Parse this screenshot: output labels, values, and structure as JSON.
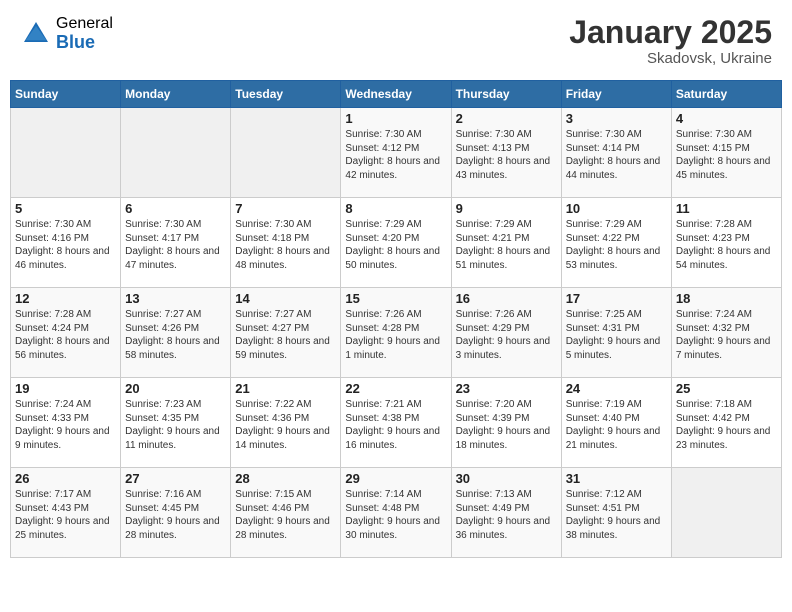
{
  "header": {
    "logo_general": "General",
    "logo_blue": "Blue",
    "month_year": "January 2025",
    "location": "Skadovsk, Ukraine"
  },
  "weekdays": [
    "Sunday",
    "Monday",
    "Tuesday",
    "Wednesday",
    "Thursday",
    "Friday",
    "Saturday"
  ],
  "weeks": [
    [
      {
        "day": "",
        "sunrise": "",
        "sunset": "",
        "daylight": ""
      },
      {
        "day": "",
        "sunrise": "",
        "sunset": "",
        "daylight": ""
      },
      {
        "day": "",
        "sunrise": "",
        "sunset": "",
        "daylight": ""
      },
      {
        "day": "1",
        "sunrise": "Sunrise: 7:30 AM",
        "sunset": "Sunset: 4:12 PM",
        "daylight": "Daylight: 8 hours and 42 minutes."
      },
      {
        "day": "2",
        "sunrise": "Sunrise: 7:30 AM",
        "sunset": "Sunset: 4:13 PM",
        "daylight": "Daylight: 8 hours and 43 minutes."
      },
      {
        "day": "3",
        "sunrise": "Sunrise: 7:30 AM",
        "sunset": "Sunset: 4:14 PM",
        "daylight": "Daylight: 8 hours and 44 minutes."
      },
      {
        "day": "4",
        "sunrise": "Sunrise: 7:30 AM",
        "sunset": "Sunset: 4:15 PM",
        "daylight": "Daylight: 8 hours and 45 minutes."
      }
    ],
    [
      {
        "day": "5",
        "sunrise": "Sunrise: 7:30 AM",
        "sunset": "Sunset: 4:16 PM",
        "daylight": "Daylight: 8 hours and 46 minutes."
      },
      {
        "day": "6",
        "sunrise": "Sunrise: 7:30 AM",
        "sunset": "Sunset: 4:17 PM",
        "daylight": "Daylight: 8 hours and 47 minutes."
      },
      {
        "day": "7",
        "sunrise": "Sunrise: 7:30 AM",
        "sunset": "Sunset: 4:18 PM",
        "daylight": "Daylight: 8 hours and 48 minutes."
      },
      {
        "day": "8",
        "sunrise": "Sunrise: 7:29 AM",
        "sunset": "Sunset: 4:20 PM",
        "daylight": "Daylight: 8 hours and 50 minutes."
      },
      {
        "day": "9",
        "sunrise": "Sunrise: 7:29 AM",
        "sunset": "Sunset: 4:21 PM",
        "daylight": "Daylight: 8 hours and 51 minutes."
      },
      {
        "day": "10",
        "sunrise": "Sunrise: 7:29 AM",
        "sunset": "Sunset: 4:22 PM",
        "daylight": "Daylight: 8 hours and 53 minutes."
      },
      {
        "day": "11",
        "sunrise": "Sunrise: 7:28 AM",
        "sunset": "Sunset: 4:23 PM",
        "daylight": "Daylight: 8 hours and 54 minutes."
      }
    ],
    [
      {
        "day": "12",
        "sunrise": "Sunrise: 7:28 AM",
        "sunset": "Sunset: 4:24 PM",
        "daylight": "Daylight: 8 hours and 56 minutes."
      },
      {
        "day": "13",
        "sunrise": "Sunrise: 7:27 AM",
        "sunset": "Sunset: 4:26 PM",
        "daylight": "Daylight: 8 hours and 58 minutes."
      },
      {
        "day": "14",
        "sunrise": "Sunrise: 7:27 AM",
        "sunset": "Sunset: 4:27 PM",
        "daylight": "Daylight: 8 hours and 59 minutes."
      },
      {
        "day": "15",
        "sunrise": "Sunrise: 7:26 AM",
        "sunset": "Sunset: 4:28 PM",
        "daylight": "Daylight: 9 hours and 1 minute."
      },
      {
        "day": "16",
        "sunrise": "Sunrise: 7:26 AM",
        "sunset": "Sunset: 4:29 PM",
        "daylight": "Daylight: 9 hours and 3 minutes."
      },
      {
        "day": "17",
        "sunrise": "Sunrise: 7:25 AM",
        "sunset": "Sunset: 4:31 PM",
        "daylight": "Daylight: 9 hours and 5 minutes."
      },
      {
        "day": "18",
        "sunrise": "Sunrise: 7:24 AM",
        "sunset": "Sunset: 4:32 PM",
        "daylight": "Daylight: 9 hours and 7 minutes."
      }
    ],
    [
      {
        "day": "19",
        "sunrise": "Sunrise: 7:24 AM",
        "sunset": "Sunset: 4:33 PM",
        "daylight": "Daylight: 9 hours and 9 minutes."
      },
      {
        "day": "20",
        "sunrise": "Sunrise: 7:23 AM",
        "sunset": "Sunset: 4:35 PM",
        "daylight": "Daylight: 9 hours and 11 minutes."
      },
      {
        "day": "21",
        "sunrise": "Sunrise: 7:22 AM",
        "sunset": "Sunset: 4:36 PM",
        "daylight": "Daylight: 9 hours and 14 minutes."
      },
      {
        "day": "22",
        "sunrise": "Sunrise: 7:21 AM",
        "sunset": "Sunset: 4:38 PM",
        "daylight": "Daylight: 9 hours and 16 minutes."
      },
      {
        "day": "23",
        "sunrise": "Sunrise: 7:20 AM",
        "sunset": "Sunset: 4:39 PM",
        "daylight": "Daylight: 9 hours and 18 minutes."
      },
      {
        "day": "24",
        "sunrise": "Sunrise: 7:19 AM",
        "sunset": "Sunset: 4:40 PM",
        "daylight": "Daylight: 9 hours and 21 minutes."
      },
      {
        "day": "25",
        "sunrise": "Sunrise: 7:18 AM",
        "sunset": "Sunset: 4:42 PM",
        "daylight": "Daylight: 9 hours and 23 minutes."
      }
    ],
    [
      {
        "day": "26",
        "sunrise": "Sunrise: 7:17 AM",
        "sunset": "Sunset: 4:43 PM",
        "daylight": "Daylight: 9 hours and 25 minutes."
      },
      {
        "day": "27",
        "sunrise": "Sunrise: 7:16 AM",
        "sunset": "Sunset: 4:45 PM",
        "daylight": "Daylight: 9 hours and 28 minutes."
      },
      {
        "day": "28",
        "sunrise": "Sunrise: 7:15 AM",
        "sunset": "Sunset: 4:46 PM",
        "daylight": "Daylight: 9 hours and 28 minutes."
      },
      {
        "day": "29",
        "sunrise": "Sunrise: 7:14 AM",
        "sunset": "Sunset: 4:48 PM",
        "daylight": "Daylight: 9 hours and 30 minutes."
      },
      {
        "day": "30",
        "sunrise": "Sunrise: 7:13 AM",
        "sunset": "Sunset: 4:49 PM",
        "daylight": "Daylight: 9 hours and 36 minutes."
      },
      {
        "day": "31",
        "sunrise": "Sunrise: 7:12 AM",
        "sunset": "Sunset: 4:51 PM",
        "daylight": "Daylight: 9 hours and 38 minutes."
      },
      {
        "day": "",
        "sunrise": "",
        "sunset": "",
        "daylight": ""
      }
    ]
  ]
}
